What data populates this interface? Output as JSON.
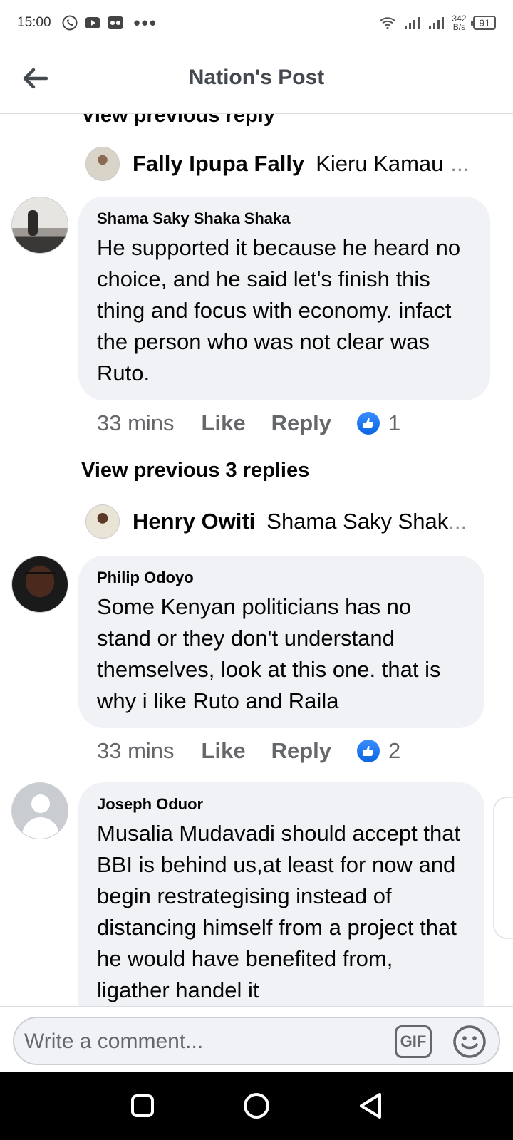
{
  "status_bar": {
    "time": "15:00",
    "more": "•••",
    "net_speed_value": "342",
    "net_speed_unit": "B/s",
    "battery": "91"
  },
  "header": {
    "title": "Nation's Post"
  },
  "thread": {
    "view_previous_reply": "View previous reply",
    "view_previous_3_replies": "View previous 3 replies",
    "reply_preview_1": {
      "name": "Fally Ipupa Fally",
      "text": "Kieru Kamau",
      "more": "..."
    },
    "reply_preview_2": {
      "name": "Henry Owiti",
      "text": "Shama Saky Shak",
      "more": "..."
    },
    "comments": [
      {
        "author": "Shama Saky Shaka Shaka",
        "text": "He supported it because he heard no choice, and he said let's finish this thing and focus with economy. infact the person who was not clear was Ruto.",
        "time": "33 mins",
        "like": "Like",
        "reply": "Reply",
        "reactions": "1"
      },
      {
        "author": "Philip Odoyo",
        "text": "Some Kenyan politicians has no stand or they don't understand themselves, look at this one. that is why i like Ruto and Raila",
        "time": "33 mins",
        "like": "Like",
        "reply": "Reply",
        "reactions": "2"
      },
      {
        "author": "Joseph Oduor",
        "text": "Musalia Mudavadi should accept that BBI is  behind us,at least for now and begin restrategising instead of  distancing himself from a project that he would have benefited from, ligather handel it"
      }
    ]
  },
  "composer": {
    "placeholder": "Write a comment...",
    "gif_label": "GIF"
  }
}
